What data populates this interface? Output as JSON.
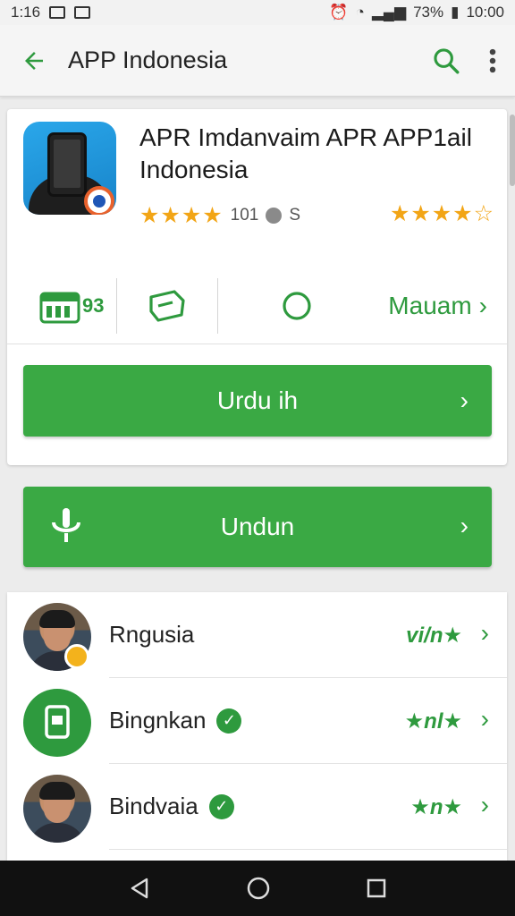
{
  "status_bar": {
    "time": "1:16",
    "battery": "73%",
    "clock": "10:00"
  },
  "app_bar": {
    "title": "APP Indonesia",
    "icons": [
      "arrow-back-icon",
      "search-icon",
      "more-vert-icon"
    ]
  },
  "app": {
    "title": "APR Imdanvaim APR APP1ail Indonesia",
    "rating_count": "101",
    "rating_suffix": "S",
    "stars_left": "★★★★",
    "stars_right": "★★★★☆"
  },
  "features": {
    "item1_label": "93",
    "item4_label": "Mauam"
  },
  "primary_button": {
    "label": "Urdu ih"
  },
  "secondary_button": {
    "label": "Undun"
  },
  "list": [
    {
      "name": "Rngusia",
      "tag": "vi/n★",
      "verified": false
    },
    {
      "name": "Bingnkan",
      "tag": "★nl★",
      "verified": true
    },
    {
      "name": "Bindvaia",
      "tag": "★n★",
      "verified": true
    }
  ],
  "colors": {
    "accent": "#3aa944",
    "accent_dark": "#2e9a3e",
    "star": "#f2a516"
  }
}
